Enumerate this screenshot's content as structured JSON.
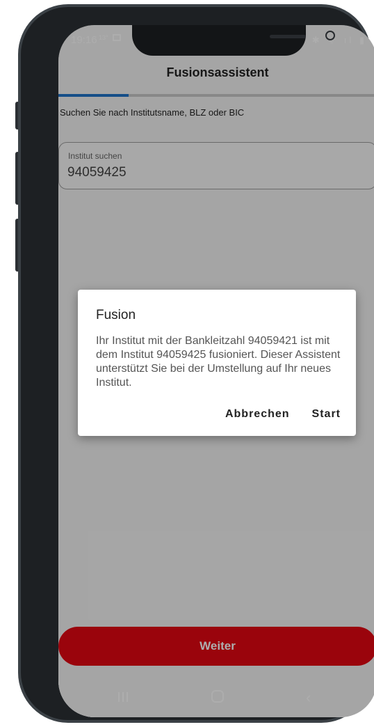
{
  "status_bar": {
    "time": "19:16",
    "temp": "13°",
    "right_icons": "✱ ᯤ ıl ▮"
  },
  "header": {
    "title": "Fusionsassistent"
  },
  "progress": {
    "fraction": 0.22,
    "color": "#1f73c9"
  },
  "instruction": "Suchen Sie nach Institutsname, BLZ oder BIC",
  "search": {
    "label": "Institut suchen",
    "value": "94059425"
  },
  "dialog": {
    "title": "Fusion",
    "body": "Ihr Institut mit der Bankleitzahl 94059421 ist mit dem Institut 94059425 fusioniert. Dieser Assistent unterstützt Sie bei der Umstellung auf Ihr neues Institut.",
    "cancel_label": "Abbrechen",
    "start_label": "Start"
  },
  "footer": {
    "continue_label": "Weiter",
    "accent": "#e30613"
  },
  "navbar": {
    "back_glyph": "‹"
  }
}
